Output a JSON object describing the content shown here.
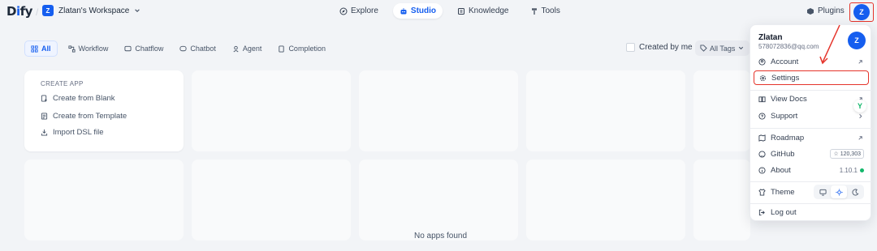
{
  "brand": {
    "logo_a": "D",
    "logo_i": "i",
    "logo_b": "fy"
  },
  "workspace": {
    "initial": "Z",
    "name": "Zlatan's Workspace"
  },
  "nav": {
    "explore": "Explore",
    "studio": "Studio",
    "knowledge": "Knowledge",
    "tools": "Tools"
  },
  "header": {
    "plugins": "Plugins",
    "avatar_initial": "Z"
  },
  "filters": {
    "all": "All",
    "workflow": "Workflow",
    "chatflow": "Chatflow",
    "chatbot": "Chatbot",
    "agent": "Agent",
    "completion": "Completion",
    "created_by_me": "Created by me",
    "all_tags": "All Tags"
  },
  "create_app": {
    "title": "CREATE APP",
    "blank": "Create from Blank",
    "template": "Create from Template",
    "dsl": "Import DSL file"
  },
  "empty_state": "No apps found",
  "user_menu": {
    "name": "Zlatan",
    "email": "578072836@qq.com",
    "avatar_initial": "Z",
    "account": "Account",
    "settings": "Settings",
    "view_docs": "View Docs",
    "support": "Support",
    "roadmap": "Roadmap",
    "github": "GitHub",
    "github_stars": "120,303",
    "about": "About",
    "version": "1.10.1",
    "theme": "Theme",
    "logout": "Log out"
  },
  "colors": {
    "accent": "#155eef",
    "highlight": "#e5342b",
    "status_ok": "#12b76a"
  }
}
